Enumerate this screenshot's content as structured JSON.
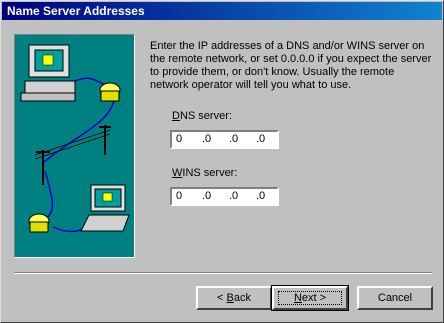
{
  "window": {
    "title": "Name Server Addresses"
  },
  "description": "Enter the IP addresses of a DNS and/or WINS server on the remote network, or set 0.0.0.0 if you expect the server to provide them, or don't know.  Usually the remote network operator will tell you what to use.",
  "dns": {
    "label_prefix": "",
    "label_mnemonic": "D",
    "label_rest": "NS server:",
    "octets": [
      "0",
      ".0",
      ".0",
      ".0"
    ]
  },
  "wins": {
    "label_prefix": "",
    "label_mnemonic": "W",
    "label_rest": "INS server:",
    "octets": [
      "0",
      ".0",
      ".0",
      ".0"
    ]
  },
  "buttons": {
    "back_prefix": "< ",
    "back_mnemonic": "B",
    "back_rest": "ack",
    "next_mnemonic": "N",
    "next_rest": "ext >",
    "cancel": "Cancel"
  },
  "illustration": {
    "icons": [
      "computer-icon",
      "telephone-icon",
      "telephone-pole-icon",
      "telephone-icon",
      "laptop-icon"
    ],
    "background_color": "#008080"
  }
}
